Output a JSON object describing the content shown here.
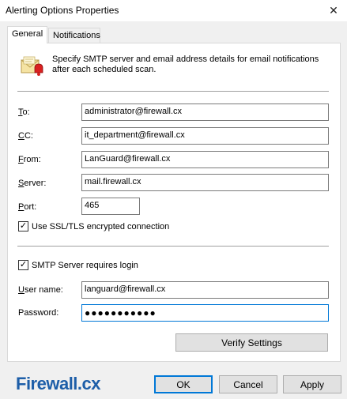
{
  "window": {
    "title": "Alerting Options Properties",
    "close_glyph": "✕"
  },
  "tabs": [
    {
      "label": "General",
      "active": true
    },
    {
      "label": "Notifications",
      "active": false
    }
  ],
  "header": {
    "description": "Specify SMTP server and email address details for email notifications after each scheduled scan.",
    "icon": "mail-alert-icon"
  },
  "fields": {
    "to": {
      "label_access": "T",
      "label_rest": "o:",
      "value": "administrator@firewall.cx"
    },
    "cc": {
      "label_access": "C",
      "label_rest": "C:",
      "value": "it_department@firewall.cx"
    },
    "from": {
      "label_access": "F",
      "label_rest": "rom:",
      "value": "LanGuard@firewall.cx"
    },
    "server": {
      "label_access": "S",
      "label_rest": "erver:",
      "value": "mail.firewall.cx"
    },
    "port": {
      "label_access": "P",
      "label_rest": "ort:",
      "value": "465"
    }
  },
  "ssl_checkbox": {
    "label": "Use SSL/TLS encrypted connection",
    "checked": true
  },
  "login_checkbox": {
    "label": "SMTP Server requires login",
    "checked": true
  },
  "login": {
    "username_label_access": "U",
    "username_label_rest": "ser name:",
    "username_value": "languard@firewall.cx",
    "password_label": "Password:",
    "password_value": "●●●●●●●●●●●"
  },
  "check_glyph": "✓",
  "buttons": {
    "verify": "Verify Settings",
    "ok": "OK",
    "cancel": "Cancel",
    "apply": "Apply"
  },
  "logo": {
    "main": "Firewall",
    "suffix": ".cx"
  },
  "colors": {
    "accent": "#0078d7",
    "logo": "#1d5ea8"
  }
}
